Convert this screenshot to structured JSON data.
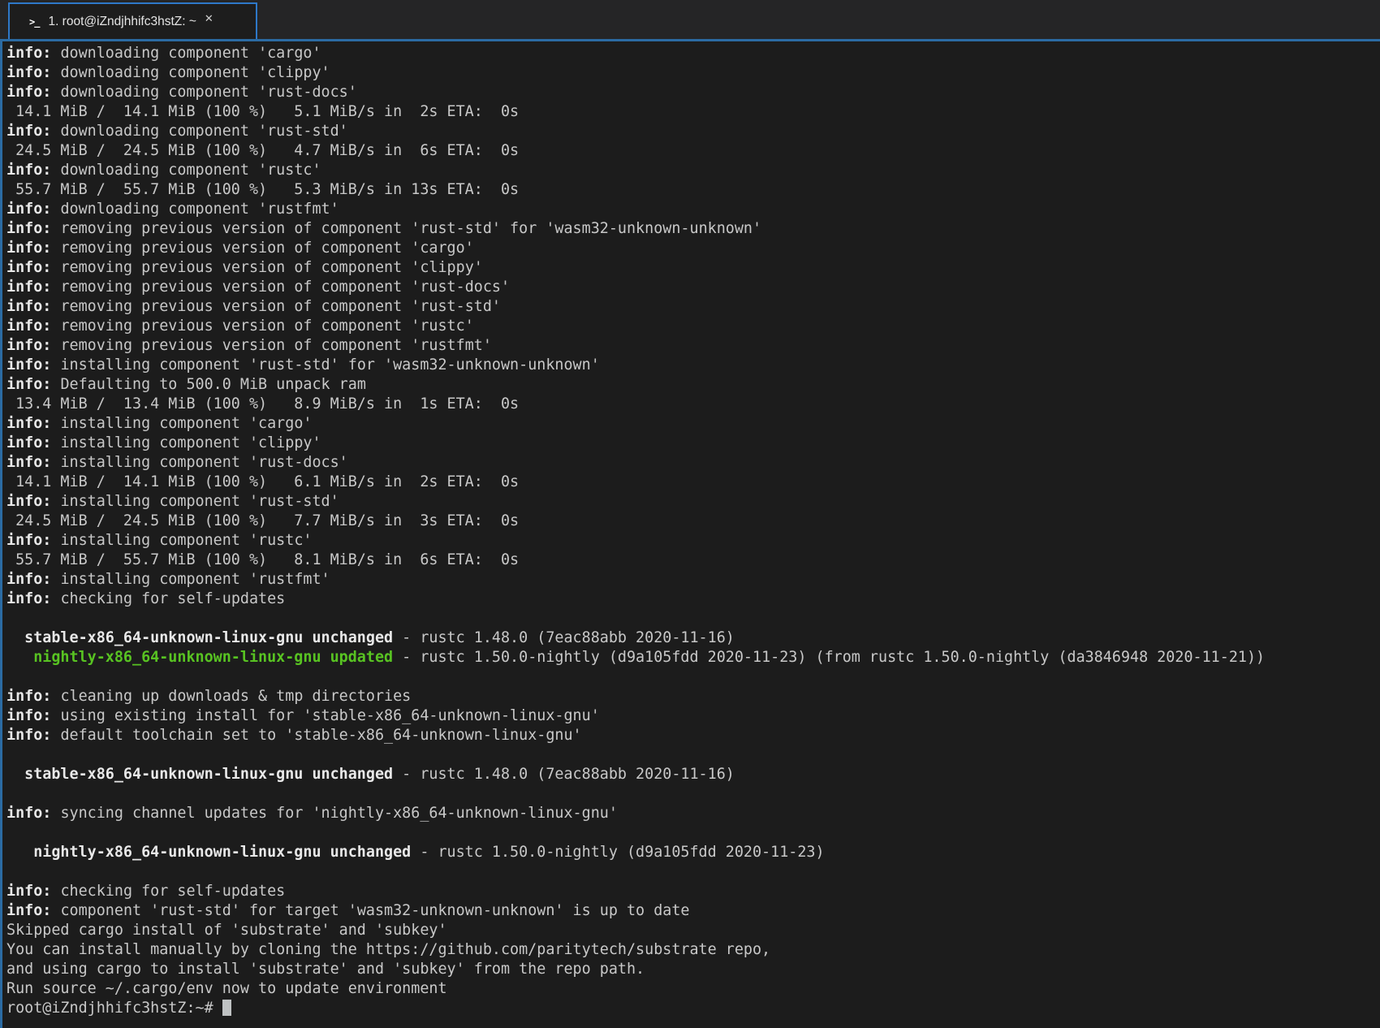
{
  "colors": {
    "accent_blue": "#2e78c8",
    "pane_border_blue": "#2b6ba3",
    "tabbar_background": "#252526",
    "terminal_background": "#1c1c1c",
    "text_normal": "#c8c8c8",
    "text_bold": "#e8e8e8",
    "text_green": "#58c322",
    "cursor": "#bfc2c3"
  },
  "tab": {
    "icon": ">_",
    "title": "1. root@iZndjhhifc3hstZ: ~",
    "close_label": "✕"
  },
  "terminal": {
    "lines": [
      {
        "segments": [
          {
            "t": "info:",
            "s": "b"
          },
          {
            "t": " downloading component 'cargo'",
            "s": "n"
          }
        ]
      },
      {
        "segments": [
          {
            "t": "info:",
            "s": "b"
          },
          {
            "t": " downloading component 'clippy'",
            "s": "n"
          }
        ]
      },
      {
        "segments": [
          {
            "t": "info:",
            "s": "b"
          },
          {
            "t": " downloading component 'rust-docs'",
            "s": "n"
          }
        ]
      },
      {
        "segments": [
          {
            "t": " 14.1 MiB /  14.1 MiB (100 %)   5.1 MiB/s in  2s ETA:  0s",
            "s": "n"
          }
        ]
      },
      {
        "segments": [
          {
            "t": "info:",
            "s": "b"
          },
          {
            "t": " downloading component 'rust-std'",
            "s": "n"
          }
        ]
      },
      {
        "segments": [
          {
            "t": " 24.5 MiB /  24.5 MiB (100 %)   4.7 MiB/s in  6s ETA:  0s",
            "s": "n"
          }
        ]
      },
      {
        "segments": [
          {
            "t": "info:",
            "s": "b"
          },
          {
            "t": " downloading component 'rustc'",
            "s": "n"
          }
        ]
      },
      {
        "segments": [
          {
            "t": " 55.7 MiB /  55.7 MiB (100 %)   5.3 MiB/s in 13s ETA:  0s",
            "s": "n"
          }
        ]
      },
      {
        "segments": [
          {
            "t": "info:",
            "s": "b"
          },
          {
            "t": " downloading component 'rustfmt'",
            "s": "n"
          }
        ]
      },
      {
        "segments": [
          {
            "t": "info:",
            "s": "b"
          },
          {
            "t": " removing previous version of component 'rust-std' for 'wasm32-unknown-unknown'",
            "s": "n"
          }
        ]
      },
      {
        "segments": [
          {
            "t": "info:",
            "s": "b"
          },
          {
            "t": " removing previous version of component 'cargo'",
            "s": "n"
          }
        ]
      },
      {
        "segments": [
          {
            "t": "info:",
            "s": "b"
          },
          {
            "t": " removing previous version of component 'clippy'",
            "s": "n"
          }
        ]
      },
      {
        "segments": [
          {
            "t": "info:",
            "s": "b"
          },
          {
            "t": " removing previous version of component 'rust-docs'",
            "s": "n"
          }
        ]
      },
      {
        "segments": [
          {
            "t": "info:",
            "s": "b"
          },
          {
            "t": " removing previous version of component 'rust-std'",
            "s": "n"
          }
        ]
      },
      {
        "segments": [
          {
            "t": "info:",
            "s": "b"
          },
          {
            "t": " removing previous version of component 'rustc'",
            "s": "n"
          }
        ]
      },
      {
        "segments": [
          {
            "t": "info:",
            "s": "b"
          },
          {
            "t": " removing previous version of component 'rustfmt'",
            "s": "n"
          }
        ]
      },
      {
        "segments": [
          {
            "t": "info:",
            "s": "b"
          },
          {
            "t": " installing component 'rust-std' for 'wasm32-unknown-unknown'",
            "s": "n"
          }
        ]
      },
      {
        "segments": [
          {
            "t": "info:",
            "s": "b"
          },
          {
            "t": " Defaulting to 500.0 MiB unpack ram",
            "s": "n"
          }
        ]
      },
      {
        "segments": [
          {
            "t": " 13.4 MiB /  13.4 MiB (100 %)   8.9 MiB/s in  1s ETA:  0s",
            "s": "n"
          }
        ]
      },
      {
        "segments": [
          {
            "t": "info:",
            "s": "b"
          },
          {
            "t": " installing component 'cargo'",
            "s": "n"
          }
        ]
      },
      {
        "segments": [
          {
            "t": "info:",
            "s": "b"
          },
          {
            "t": " installing component 'clippy'",
            "s": "n"
          }
        ]
      },
      {
        "segments": [
          {
            "t": "info:",
            "s": "b"
          },
          {
            "t": " installing component 'rust-docs'",
            "s": "n"
          }
        ]
      },
      {
        "segments": [
          {
            "t": " 14.1 MiB /  14.1 MiB (100 %)   6.1 MiB/s in  2s ETA:  0s",
            "s": "n"
          }
        ]
      },
      {
        "segments": [
          {
            "t": "info:",
            "s": "b"
          },
          {
            "t": " installing component 'rust-std'",
            "s": "n"
          }
        ]
      },
      {
        "segments": [
          {
            "t": " 24.5 MiB /  24.5 MiB (100 %)   7.7 MiB/s in  3s ETA:  0s",
            "s": "n"
          }
        ]
      },
      {
        "segments": [
          {
            "t": "info:",
            "s": "b"
          },
          {
            "t": " installing component 'rustc'",
            "s": "n"
          }
        ]
      },
      {
        "segments": [
          {
            "t": " 55.7 MiB /  55.7 MiB (100 %)   8.1 MiB/s in  6s ETA:  0s",
            "s": "n"
          }
        ]
      },
      {
        "segments": [
          {
            "t": "info:",
            "s": "b"
          },
          {
            "t": " installing component 'rustfmt'",
            "s": "n"
          }
        ]
      },
      {
        "segments": [
          {
            "t": "info:",
            "s": "b"
          },
          {
            "t": " checking for self-updates",
            "s": "n"
          }
        ]
      },
      {
        "segments": []
      },
      {
        "segments": [
          {
            "t": "  stable-x86_64-unknown-linux-gnu unchanged",
            "s": "b"
          },
          {
            "t": " - rustc 1.48.0 (7eac88abb 2020-11-16)",
            "s": "n"
          }
        ]
      },
      {
        "segments": [
          {
            "t": "   nightly-x86_64-unknown-linux-gnu updated",
            "s": "g"
          },
          {
            "t": " - rustc 1.50.0-nightly (d9a105fdd 2020-11-23) (from rustc 1.50.0-nightly (da3846948 2020-11-21))",
            "s": "n"
          }
        ]
      },
      {
        "segments": []
      },
      {
        "segments": [
          {
            "t": "info:",
            "s": "b"
          },
          {
            "t": " cleaning up downloads & tmp directories",
            "s": "n"
          }
        ]
      },
      {
        "segments": [
          {
            "t": "info:",
            "s": "b"
          },
          {
            "t": " using existing install for 'stable-x86_64-unknown-linux-gnu'",
            "s": "n"
          }
        ]
      },
      {
        "segments": [
          {
            "t": "info:",
            "s": "b"
          },
          {
            "t": " default toolchain set to 'stable-x86_64-unknown-linux-gnu'",
            "s": "n"
          }
        ]
      },
      {
        "segments": []
      },
      {
        "segments": [
          {
            "t": "  stable-x86_64-unknown-linux-gnu unchanged",
            "s": "b"
          },
          {
            "t": " - rustc 1.48.0 (7eac88abb 2020-11-16)",
            "s": "n"
          }
        ]
      },
      {
        "segments": []
      },
      {
        "segments": [
          {
            "t": "info:",
            "s": "b"
          },
          {
            "t": " syncing channel updates for 'nightly-x86_64-unknown-linux-gnu'",
            "s": "n"
          }
        ]
      },
      {
        "segments": []
      },
      {
        "segments": [
          {
            "t": "   nightly-x86_64-unknown-linux-gnu unchanged",
            "s": "b"
          },
          {
            "t": " - rustc 1.50.0-nightly (d9a105fdd 2020-11-23)",
            "s": "n"
          }
        ]
      },
      {
        "segments": []
      },
      {
        "segments": [
          {
            "t": "info:",
            "s": "b"
          },
          {
            "t": " checking for self-updates",
            "s": "n"
          }
        ]
      },
      {
        "segments": [
          {
            "t": "info:",
            "s": "b"
          },
          {
            "t": " component 'rust-std' for target 'wasm32-unknown-unknown' is up to date",
            "s": "n"
          }
        ]
      },
      {
        "segments": [
          {
            "t": "Skipped cargo install of 'substrate' and 'subkey'",
            "s": "n"
          }
        ]
      },
      {
        "segments": [
          {
            "t": "You can install manually by cloning the https://github.com/paritytech/substrate repo,",
            "s": "n"
          }
        ]
      },
      {
        "segments": [
          {
            "t": "and using cargo to install 'substrate' and 'subkey' from the repo path.",
            "s": "n"
          }
        ]
      },
      {
        "segments": [
          {
            "t": "Run source ~/.cargo/env now to update environment",
            "s": "n"
          }
        ]
      },
      {
        "segments": [
          {
            "t": "root@iZndjhhifc3hstZ:~# ",
            "s": "n"
          }
        ],
        "cursor": true
      }
    ]
  }
}
